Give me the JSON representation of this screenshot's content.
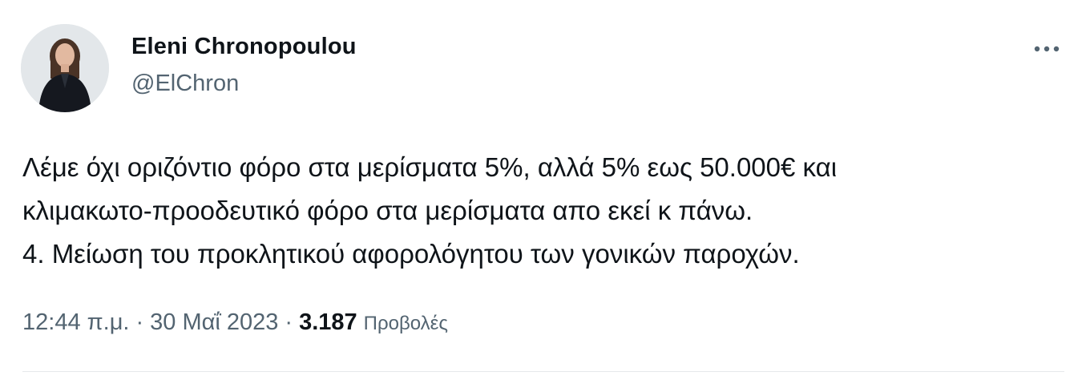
{
  "author": {
    "display_name": "Eleni Chronopoulou",
    "handle": "@ElChron",
    "avatar_icon": "profile-photo"
  },
  "tweet": {
    "lines": [
      "Λέμε όχι οριζόντιο φόρο στα μερίσματα 5%, αλλά 5% εως 50.000€ και",
      "κλιμακωτο-προοδευτικό φόρο στα μερίσματα απο εκεί κ πάνω.",
      "4. Μείωση του προκλητικού αφορολόγητου των γονικών παροχών."
    ]
  },
  "meta": {
    "time": "12:44 π.μ.",
    "date": "30 Μαΐ 2023",
    "separator": "·",
    "views_count": "3.187",
    "views_label": "Προβολές"
  },
  "icons": {
    "more": "more-options-icon"
  },
  "colors": {
    "text": "#0f1419",
    "secondary": "#536471",
    "divider": "#e6e9eb"
  }
}
